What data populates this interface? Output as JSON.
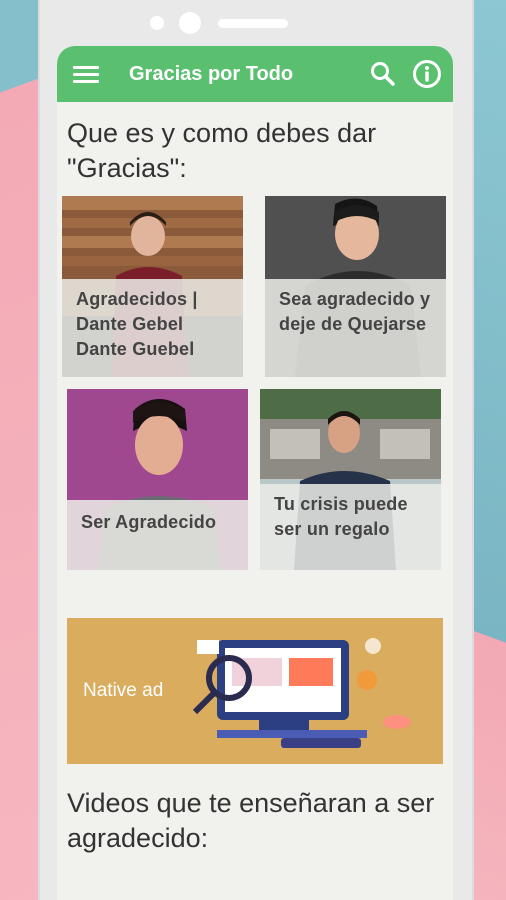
{
  "app": {
    "title": "Gracias por Todo"
  },
  "sections": {
    "first_heading": "Que es y como debes dar \"Gracias\":",
    "second_heading": "Videos que te enseñaran a ser agradecido:"
  },
  "cards": [
    {
      "title": "Agradecidos | Dante Gebel Dante Guebel"
    },
    {
      "title": "Sea agradecido y deje de Quejarse"
    },
    {
      "title": "Ser Agradecido"
    },
    {
      "title": "Tu crisis puede ser un regalo"
    }
  ],
  "ad": {
    "label": "Native ad"
  },
  "colors": {
    "appbar": "#5ac070",
    "ad_background": "#d9ac5e"
  },
  "icons": {
    "menu": "menu-icon",
    "search": "search-icon",
    "info": "info-icon"
  }
}
